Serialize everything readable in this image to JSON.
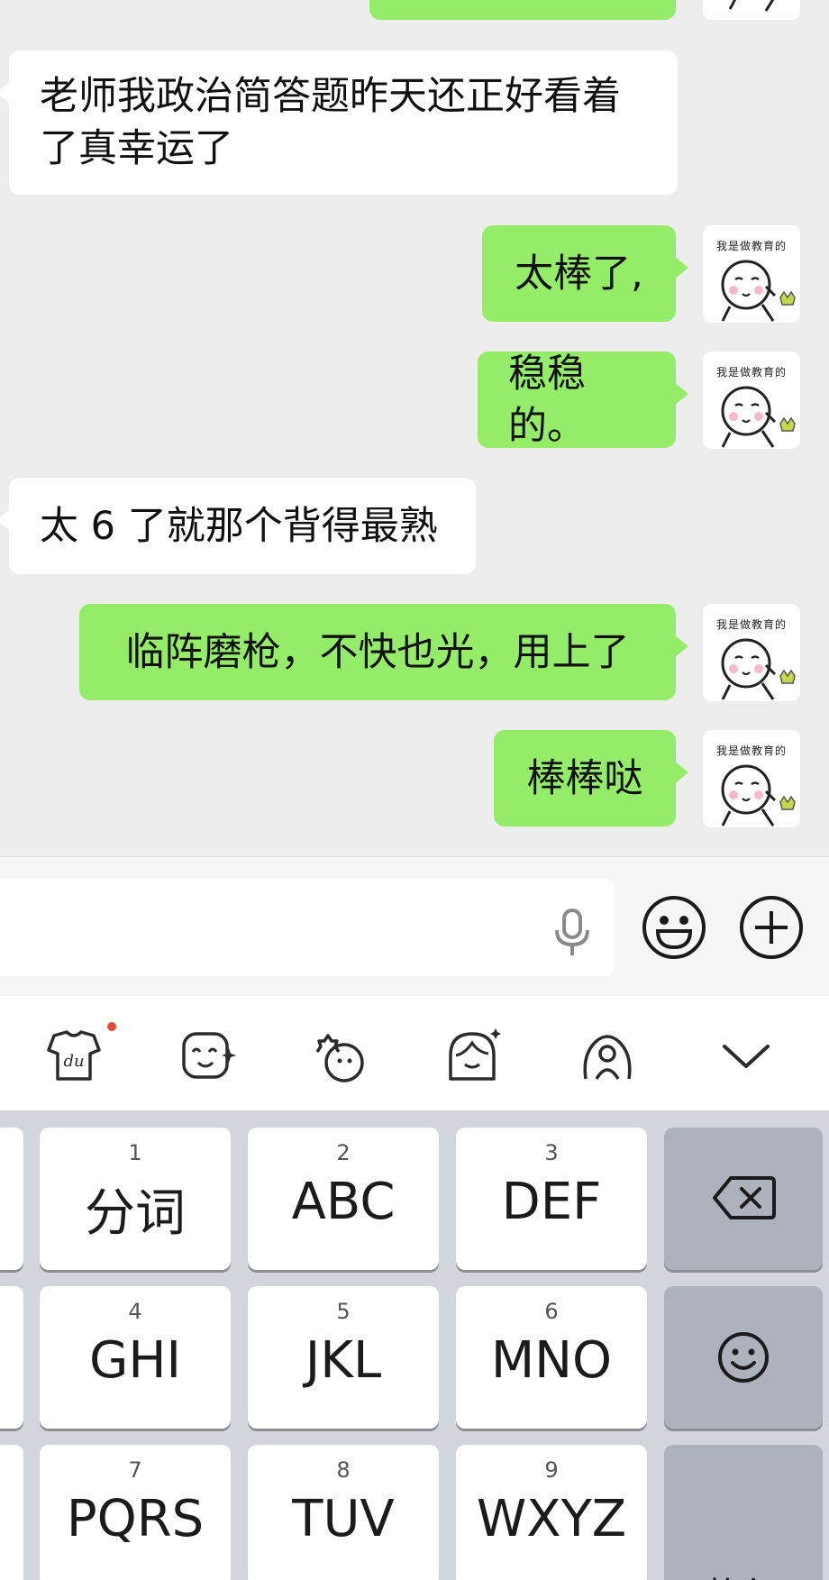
{
  "messages": [
    {
      "side": "in",
      "text": "老师我政治简答题昨天还正好看着了真幸运了"
    },
    {
      "side": "out",
      "text": "太棒了,"
    },
    {
      "side": "out",
      "text": "稳稳的。"
    },
    {
      "side": "in",
      "text": "太 6 了就那个背得最熟"
    },
    {
      "side": "out",
      "text": "临阵磨枪，不快也光，用上了"
    },
    {
      "side": "out",
      "text": "棒棒哒"
    }
  ],
  "avatar_caption": "我是做教育的",
  "input": {
    "value": "",
    "icons": [
      "microphone-icon",
      "emoji-icon",
      "plus-icon"
    ]
  },
  "ime_toolbar": {
    "icons": [
      "du-skin-icon",
      "emoticon-icon",
      "sticker-icon",
      "avatar-icon",
      "handwriting-icon",
      "collapse-chevron-icon"
    ],
    "notification_dot_color": "#e64a3b"
  },
  "keys": [
    {
      "num": "1",
      "label": "分词"
    },
    {
      "num": "2",
      "label": "ABC"
    },
    {
      "num": "3",
      "label": "DEF"
    },
    {
      "num": "4",
      "label": "GHI"
    },
    {
      "num": "5",
      "label": "JKL"
    },
    {
      "num": "6",
      "label": "MNO"
    },
    {
      "num": "7",
      "label": "PQRS"
    },
    {
      "num": "8",
      "label": "TUV"
    },
    {
      "num": "9",
      "label": "WXYZ"
    }
  ],
  "function_keys": {
    "return_label": "换行",
    "backspace_icon": "backspace-icon",
    "emoji_icon": "emoji-icon"
  },
  "colors": {
    "bubble_out": "#95ec69",
    "bubble_in": "#ffffff",
    "chat_bg": "#ededed",
    "keyboard_bg": "#d2d5db"
  }
}
